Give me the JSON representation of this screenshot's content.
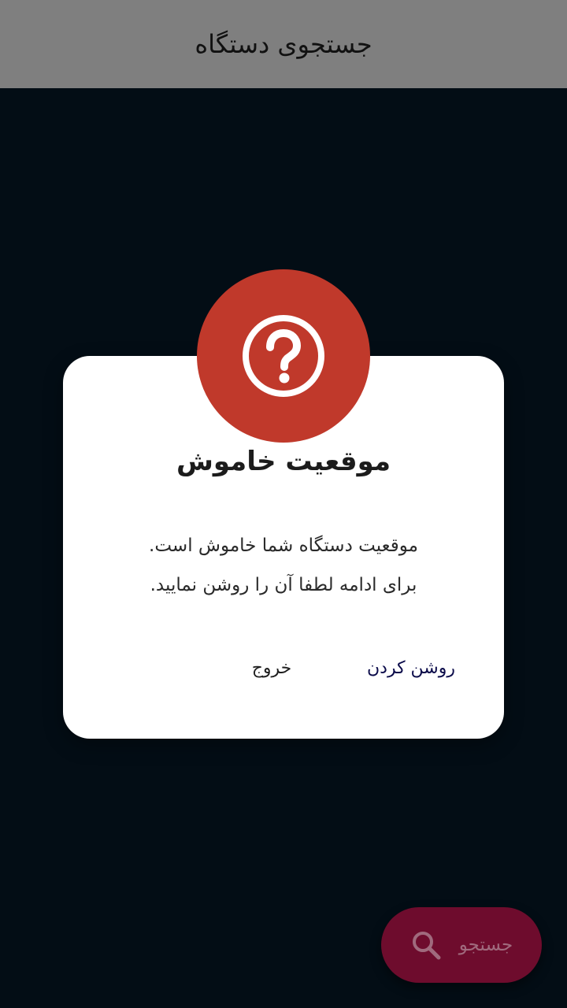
{
  "app_bar": {
    "title": "جستجوی دستگاه"
  },
  "dialog": {
    "icon": "question-circle-icon",
    "title": "موقعیت خاموش",
    "message_lines": [
      "موقعیت دستگاه شما خاموش است.",
      "برای ادامه لطفا آن را روشن نمایید."
    ],
    "confirm_label": "روشن کردن",
    "exit_label": "خروج"
  },
  "fab": {
    "icon": "search-icon",
    "label": "جستجو"
  },
  "colors": {
    "app_bar": "#7f7f7f",
    "background": "#030d15",
    "badge": "#c0392b",
    "fab": "#6e0c2d",
    "confirm_text": "#0b0b4a"
  }
}
